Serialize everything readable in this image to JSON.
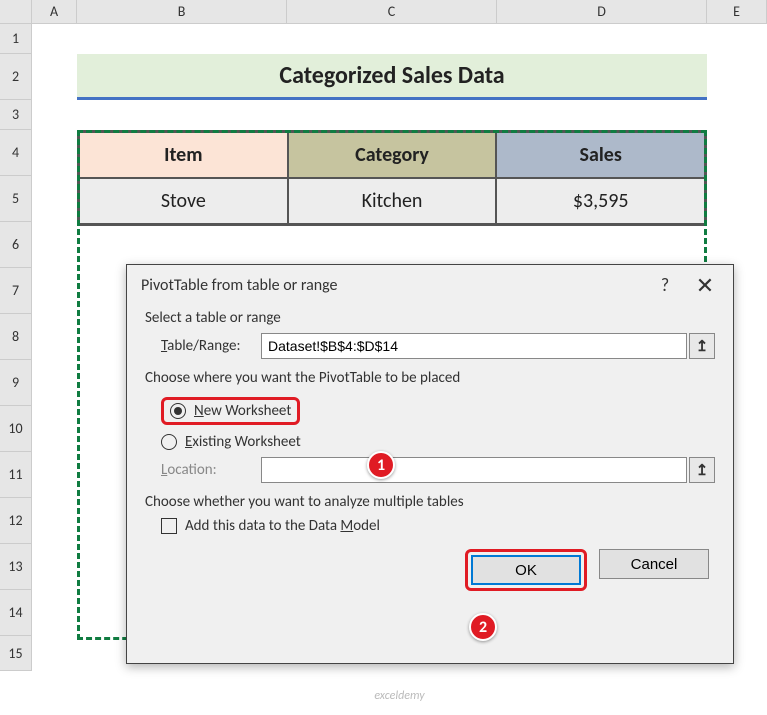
{
  "columns": [
    "A",
    "B",
    "C",
    "D",
    "E"
  ],
  "rows": [
    "1",
    "2",
    "3",
    "4",
    "5",
    "6",
    "7",
    "8",
    "9",
    "10",
    "11",
    "12",
    "13",
    "14",
    "15"
  ],
  "title": "Categorized Sales Data",
  "table": {
    "headers": [
      "Item",
      "Category",
      "Sales"
    ],
    "rows": [
      [
        "Stove",
        "Kitchen",
        "$3,595"
      ]
    ]
  },
  "dialog": {
    "title": "PivotTable from table or range",
    "help": "?",
    "close": "✕",
    "section1_label": "Select a table or range",
    "range_label": "Table/Range:",
    "range_value": "Dataset!$B$4:$D$14",
    "collapse_icon": "↥",
    "section2_label": "Choose where you want the PivotTable to be placed",
    "radio_new": "New Worksheet",
    "radio_existing": "Existing Worksheet",
    "location_label": "Location:",
    "location_value": "",
    "section3_label": "Choose whether you want to analyze multiple tables",
    "checkbox_label": "Add this data to the Data Model",
    "ok": "OK",
    "cancel": "Cancel"
  },
  "callouts": {
    "one": "1",
    "two": "2"
  },
  "watermark": "exceldemy"
}
